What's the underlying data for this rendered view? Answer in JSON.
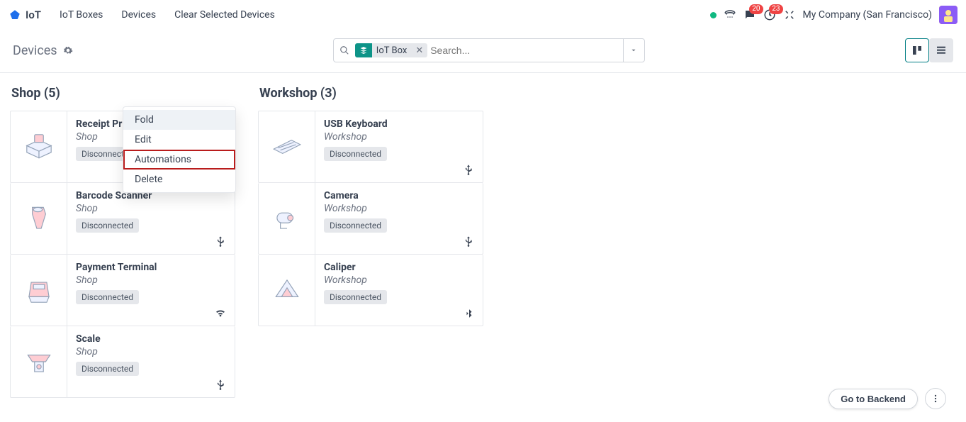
{
  "nav": {
    "app": "IoT",
    "menu": [
      "IoT Boxes",
      "Devices",
      "Clear Selected Devices"
    ],
    "badges": {
      "messages": "20",
      "activities": "23"
    },
    "company": "My Company (San Francisco)"
  },
  "controlPanel": {
    "title": "Devices",
    "filterChip": "IoT Box",
    "searchPlaceholder": "Search..."
  },
  "columns": [
    {
      "title": "Shop (5)",
      "cards": [
        {
          "title": "Receipt Printer",
          "sub": "Shop",
          "status": "Disconnected",
          "conn": "none"
        },
        {
          "title": "Barcode Scanner",
          "sub": "Shop",
          "status": "Disconnected",
          "conn": "usb"
        },
        {
          "title": "Payment Terminal",
          "sub": "Shop",
          "status": "Disconnected",
          "conn": "wifi"
        },
        {
          "title": "Scale",
          "sub": "Shop",
          "status": "Disconnected",
          "conn": "usb"
        }
      ]
    },
    {
      "title": "Workshop (3)",
      "cards": [
        {
          "title": "USB Keyboard",
          "sub": "Workshop",
          "status": "Disconnected",
          "conn": "usb"
        },
        {
          "title": "Camera",
          "sub": "Workshop",
          "status": "Disconnected",
          "conn": "usb"
        },
        {
          "title": "Caliper",
          "sub": "Workshop",
          "status": "Disconnected",
          "conn": "bluetooth"
        }
      ]
    }
  ],
  "contextMenu": {
    "items": [
      "Fold",
      "Edit",
      "Automations",
      "Delete"
    ],
    "hoverIndex": 0,
    "highlightIndex": 2
  },
  "footer": {
    "backend": "Go to Backend"
  },
  "icons": {
    "printer": "printer",
    "scanner": "scanner",
    "terminal": "terminal",
    "scale": "scale",
    "keyboard": "keyboard",
    "camera": "camera",
    "caliper": "caliper"
  }
}
